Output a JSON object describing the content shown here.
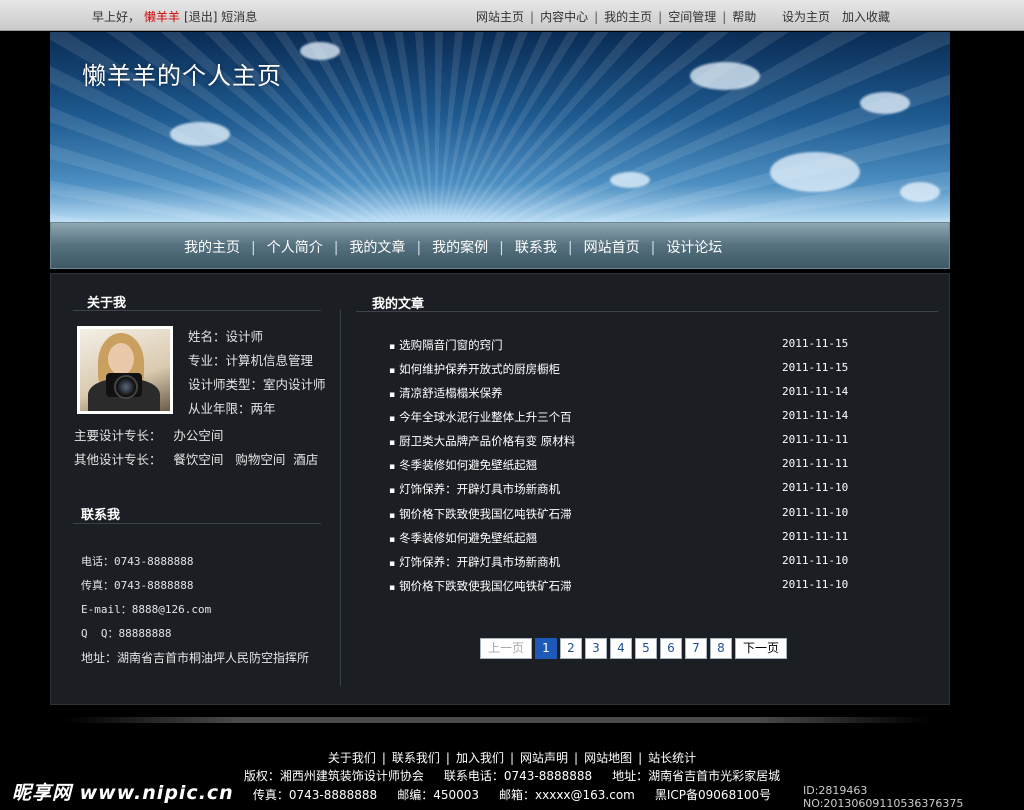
{
  "topbar": {
    "greeting": "早上好，",
    "username": "懒羊羊",
    "logout": "[退出]",
    "messages": "短消息",
    "links": [
      "网站主页",
      "内容中心",
      "我的主页",
      "空间管理",
      "帮助"
    ],
    "set_home": "设为主页",
    "bookmark": "加入收藏"
  },
  "banner": {
    "title": "懒羊羊的个人主页"
  },
  "nav": {
    "items": [
      "我的主页",
      "个人简介",
      "我的文章",
      "我的案例",
      "联系我",
      "网站首页",
      "设计论坛"
    ]
  },
  "about": {
    "heading": "关于我",
    "name": "姓名：设计师",
    "major": "专业：计算机信息管理",
    "designer_type": "设计师类型：室内设计师",
    "years": "从业年限：两年",
    "main_specialty": "主要设计专长：   办公空间",
    "other_specialty": "其他设计专长：   餐饮空间   购物空间  酒店"
  },
  "contact": {
    "heading": "联系我",
    "phone": "电话：0743-8888888",
    "fax": "传真：0743-8888888",
    "email": "E-mail：8888@126.com",
    "qq": "Q  Q：88888888",
    "address": "地址：湖南省吉首市桐油坪人民防空指挥所"
  },
  "articles": {
    "heading": "我的文章",
    "items": [
      {
        "title": "选购隔音门窗的窍门",
        "date": "2011-11-15"
      },
      {
        "title": "如何维护保养开放式的厨房橱柜",
        "date": "2011-11-15"
      },
      {
        "title": "清凉舒适榻榻米保养",
        "date": "2011-11-14"
      },
      {
        "title": "今年全球水泥行业整体上升三个百",
        "date": "2011-11-14"
      },
      {
        "title": "厨卫类大品牌产品价格有变 原材料",
        "date": "2011-11-11"
      },
      {
        "title": "冬季装修如何避免壁纸起翘",
        "date": "2011-11-11"
      },
      {
        "title": "灯饰保养：开辟灯具市场新商机",
        "date": "2011-11-10"
      },
      {
        "title": "钢价格下跌致使我国亿吨铁矿石滞",
        "date": "2011-11-10"
      },
      {
        "title": "冬季装修如何避免壁纸起翘",
        "date": "2011-11-11"
      },
      {
        "title": "灯饰保养：开辟灯具市场新商机",
        "date": "2011-11-10"
      },
      {
        "title": "钢价格下跌致使我国亿吨铁矿石滞",
        "date": "2011-11-10"
      }
    ]
  },
  "pagination": {
    "prev": "上一页",
    "pages": [
      "1",
      "2",
      "3",
      "4",
      "5",
      "6",
      "7",
      "8"
    ],
    "current": "1",
    "next": "下一页"
  },
  "footer": {
    "links": [
      "关于我们",
      "联系我们",
      "加入我们",
      "网站声明",
      "网站地图",
      "站长统计"
    ],
    "copyright": "版权：湘西州建筑装饰设计师协会",
    "phone": "联系电话：0743-8888888",
    "address": "地址：湖南省吉首市光彩家居城",
    "fax": "传真：0743-8888888",
    "postcode": "邮编：450003",
    "email": "邮箱：xxxxx@163.com",
    "icp": "黑ICP备09068100号"
  },
  "watermark": {
    "logo": "昵享网 www.nipic.cn",
    "id": "ID:2819463 NO:20130609110536376375"
  }
}
